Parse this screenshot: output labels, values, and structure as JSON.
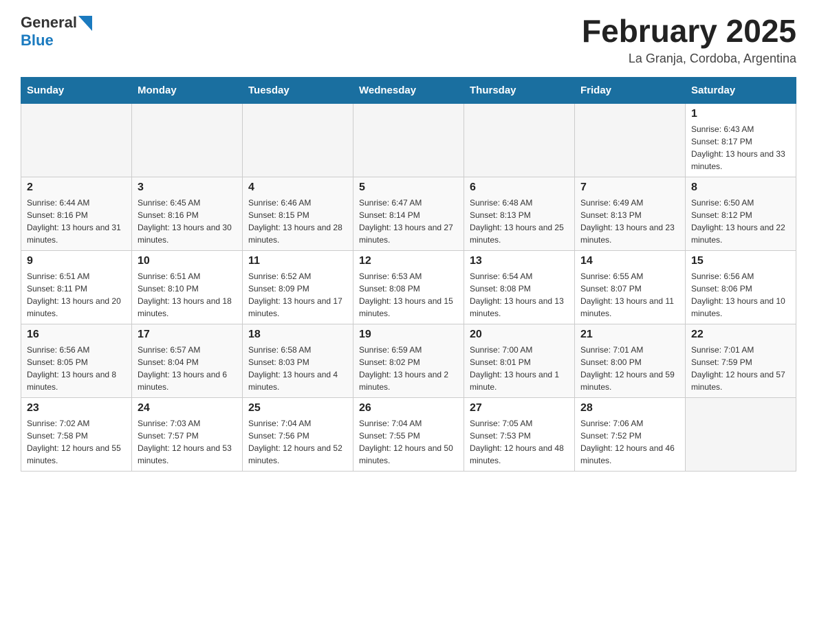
{
  "header": {
    "logo_general": "General",
    "logo_blue": "Blue",
    "month_title": "February 2025",
    "location": "La Granja, Cordoba, Argentina"
  },
  "days_of_week": [
    "Sunday",
    "Monday",
    "Tuesday",
    "Wednesday",
    "Thursday",
    "Friday",
    "Saturday"
  ],
  "weeks": [
    [
      {
        "day": "",
        "info": ""
      },
      {
        "day": "",
        "info": ""
      },
      {
        "day": "",
        "info": ""
      },
      {
        "day": "",
        "info": ""
      },
      {
        "day": "",
        "info": ""
      },
      {
        "day": "",
        "info": ""
      },
      {
        "day": "1",
        "info": "Sunrise: 6:43 AM\nSunset: 8:17 PM\nDaylight: 13 hours and 33 minutes."
      }
    ],
    [
      {
        "day": "2",
        "info": "Sunrise: 6:44 AM\nSunset: 8:16 PM\nDaylight: 13 hours and 31 minutes."
      },
      {
        "day": "3",
        "info": "Sunrise: 6:45 AM\nSunset: 8:16 PM\nDaylight: 13 hours and 30 minutes."
      },
      {
        "day": "4",
        "info": "Sunrise: 6:46 AM\nSunset: 8:15 PM\nDaylight: 13 hours and 28 minutes."
      },
      {
        "day": "5",
        "info": "Sunrise: 6:47 AM\nSunset: 8:14 PM\nDaylight: 13 hours and 27 minutes."
      },
      {
        "day": "6",
        "info": "Sunrise: 6:48 AM\nSunset: 8:13 PM\nDaylight: 13 hours and 25 minutes."
      },
      {
        "day": "7",
        "info": "Sunrise: 6:49 AM\nSunset: 8:13 PM\nDaylight: 13 hours and 23 minutes."
      },
      {
        "day": "8",
        "info": "Sunrise: 6:50 AM\nSunset: 8:12 PM\nDaylight: 13 hours and 22 minutes."
      }
    ],
    [
      {
        "day": "9",
        "info": "Sunrise: 6:51 AM\nSunset: 8:11 PM\nDaylight: 13 hours and 20 minutes."
      },
      {
        "day": "10",
        "info": "Sunrise: 6:51 AM\nSunset: 8:10 PM\nDaylight: 13 hours and 18 minutes."
      },
      {
        "day": "11",
        "info": "Sunrise: 6:52 AM\nSunset: 8:09 PM\nDaylight: 13 hours and 17 minutes."
      },
      {
        "day": "12",
        "info": "Sunrise: 6:53 AM\nSunset: 8:08 PM\nDaylight: 13 hours and 15 minutes."
      },
      {
        "day": "13",
        "info": "Sunrise: 6:54 AM\nSunset: 8:08 PM\nDaylight: 13 hours and 13 minutes."
      },
      {
        "day": "14",
        "info": "Sunrise: 6:55 AM\nSunset: 8:07 PM\nDaylight: 13 hours and 11 minutes."
      },
      {
        "day": "15",
        "info": "Sunrise: 6:56 AM\nSunset: 8:06 PM\nDaylight: 13 hours and 10 minutes."
      }
    ],
    [
      {
        "day": "16",
        "info": "Sunrise: 6:56 AM\nSunset: 8:05 PM\nDaylight: 13 hours and 8 minutes."
      },
      {
        "day": "17",
        "info": "Sunrise: 6:57 AM\nSunset: 8:04 PM\nDaylight: 13 hours and 6 minutes."
      },
      {
        "day": "18",
        "info": "Sunrise: 6:58 AM\nSunset: 8:03 PM\nDaylight: 13 hours and 4 minutes."
      },
      {
        "day": "19",
        "info": "Sunrise: 6:59 AM\nSunset: 8:02 PM\nDaylight: 13 hours and 2 minutes."
      },
      {
        "day": "20",
        "info": "Sunrise: 7:00 AM\nSunset: 8:01 PM\nDaylight: 13 hours and 1 minute."
      },
      {
        "day": "21",
        "info": "Sunrise: 7:01 AM\nSunset: 8:00 PM\nDaylight: 12 hours and 59 minutes."
      },
      {
        "day": "22",
        "info": "Sunrise: 7:01 AM\nSunset: 7:59 PM\nDaylight: 12 hours and 57 minutes."
      }
    ],
    [
      {
        "day": "23",
        "info": "Sunrise: 7:02 AM\nSunset: 7:58 PM\nDaylight: 12 hours and 55 minutes."
      },
      {
        "day": "24",
        "info": "Sunrise: 7:03 AM\nSunset: 7:57 PM\nDaylight: 12 hours and 53 minutes."
      },
      {
        "day": "25",
        "info": "Sunrise: 7:04 AM\nSunset: 7:56 PM\nDaylight: 12 hours and 52 minutes."
      },
      {
        "day": "26",
        "info": "Sunrise: 7:04 AM\nSunset: 7:55 PM\nDaylight: 12 hours and 50 minutes."
      },
      {
        "day": "27",
        "info": "Sunrise: 7:05 AM\nSunset: 7:53 PM\nDaylight: 12 hours and 48 minutes."
      },
      {
        "day": "28",
        "info": "Sunrise: 7:06 AM\nSunset: 7:52 PM\nDaylight: 12 hours and 46 minutes."
      },
      {
        "day": "",
        "info": ""
      }
    ]
  ]
}
